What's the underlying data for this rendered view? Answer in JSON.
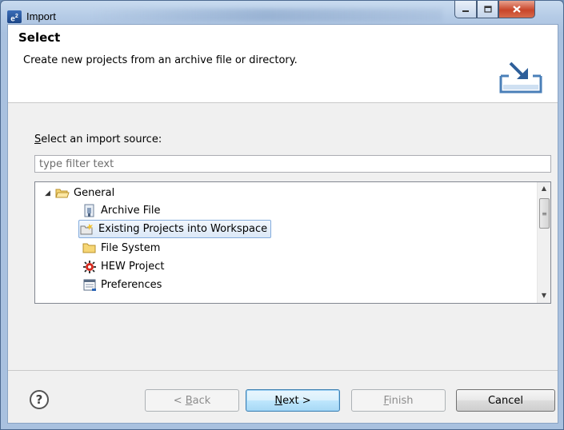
{
  "window": {
    "title": "Import",
    "app_icon": "e2",
    "controls": [
      "minimize-icon",
      "maximize-icon",
      "close-icon"
    ]
  },
  "header": {
    "title": "Select",
    "description": "Create new projects from an archive file or directory.",
    "icon": "import-wizard-icon"
  },
  "source": {
    "label": "Select an import source:",
    "label_mnemonic": "S",
    "label_rest": "elect an import source:"
  },
  "filter": {
    "placeholder": "type filter text",
    "value": ""
  },
  "tree": {
    "root": {
      "label": "General",
      "expanded": true,
      "icon": "folder-open-icon"
    },
    "items": [
      {
        "label": "Archive File",
        "icon": "archive-file-icon",
        "selected": false
      },
      {
        "label": "Existing Projects into Workspace",
        "icon": "existing-projects-icon",
        "selected": true
      },
      {
        "label": "File System",
        "icon": "folder-icon",
        "selected": false
      },
      {
        "label": "HEW Project",
        "icon": "hew-project-icon",
        "selected": false
      },
      {
        "label": "Preferences",
        "icon": "preferences-icon",
        "selected": false
      }
    ]
  },
  "buttons": {
    "help": "?",
    "back_prefix": "< ",
    "back_mnemonic": "B",
    "back_rest": "ack",
    "next_mnemonic": "N",
    "next_rest": "ext >",
    "finish_mnemonic": "F",
    "finish_rest": "inish",
    "cancel": "Cancel"
  },
  "colors": {
    "selection_border": "#84acdd",
    "default_button_border": "#3c7fb1",
    "close_button": "#c8452a"
  }
}
